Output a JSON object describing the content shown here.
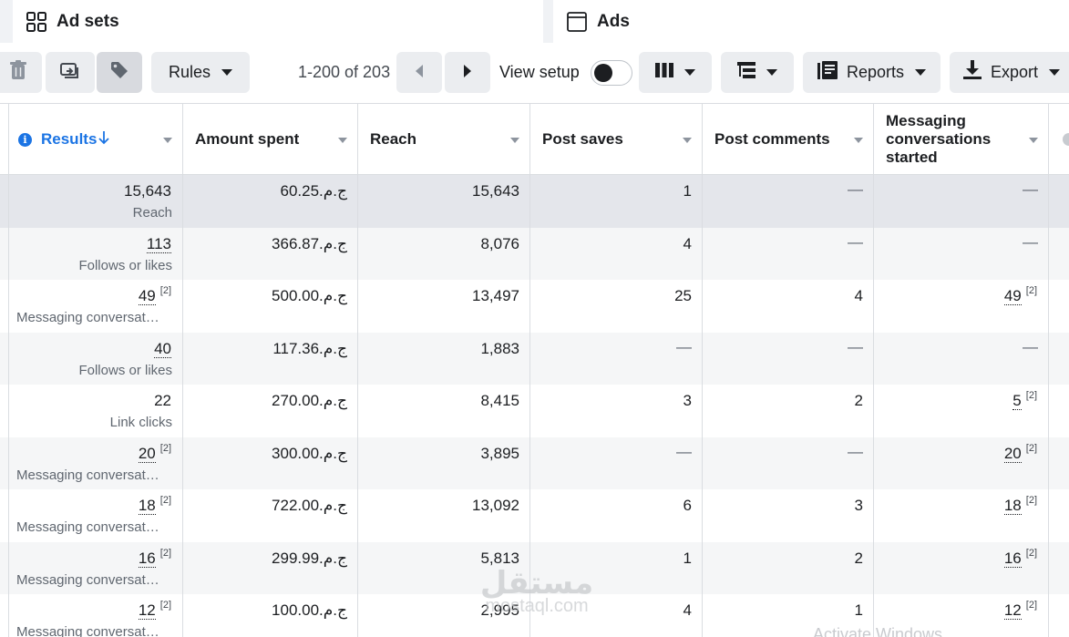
{
  "tabs": {
    "adsets_label": "Ad sets",
    "ads_label": "Ads"
  },
  "toolbar": {
    "rules_label": "Rules",
    "pagination": "1-200 of 203",
    "view_setup_label": "View setup",
    "reports_label": "Reports",
    "export_label": "Export"
  },
  "table": {
    "headers": {
      "results": "Results",
      "amount_spent": "Amount spent",
      "reach": "Reach",
      "post_saves": "Post saves",
      "post_comments": "Post comments",
      "messaging": "Messaging conversations started"
    },
    "rows": [
      {
        "results": "15,643",
        "results_sub": "Reach",
        "amount": "ج.م.60.25",
        "reach": "15,643",
        "saves": "1",
        "comments": "—",
        "messaging": "—"
      },
      {
        "results": "113",
        "results_sub": "Follows or likes",
        "amount": "ج.م.366.87",
        "reach": "8,076",
        "saves": "4",
        "comments": "—",
        "messaging": "—"
      },
      {
        "results": "49",
        "results_sub": "Messaging conversat…",
        "amount": "ج.م.500.00",
        "reach": "13,497",
        "saves": "25",
        "comments": "4",
        "messaging": "49"
      },
      {
        "results": "40",
        "results_sub": "Follows or likes",
        "amount": "ج.م.117.36",
        "reach": "1,883",
        "saves": "—",
        "comments": "—",
        "messaging": "—"
      },
      {
        "results": "22",
        "results_sub": "Link clicks",
        "amount": "ج.م.270.00",
        "reach": "8,415",
        "saves": "3",
        "comments": "2",
        "messaging": "5"
      },
      {
        "results": "20",
        "results_sub": "Messaging conversat…",
        "amount": "ج.م.300.00",
        "reach": "3,895",
        "saves": "—",
        "comments": "—",
        "messaging": "20"
      },
      {
        "results": "18",
        "results_sub": "Messaging conversat…",
        "amount": "ج.م.722.00",
        "reach": "13,092",
        "saves": "6",
        "comments": "3",
        "messaging": "18"
      },
      {
        "results": "16",
        "results_sub": "Messaging conversat…",
        "amount": "ج.م.299.99",
        "reach": "5,813",
        "saves": "1",
        "comments": "2",
        "messaging": "16"
      },
      {
        "results": "12",
        "results_sub": "Messaging conversat…",
        "amount": "ج.م.100.00",
        "reach": "2,995",
        "saves": "4",
        "comments": "1",
        "messaging": "12"
      }
    ],
    "footnote_marker": "[2]"
  },
  "watermark": {
    "line1": "مستقل",
    "line2": "mostaql.com"
  },
  "system_overlay": "Activate Windows",
  "colors": {
    "accent": "#1b74e4",
    "button_bg": "#ebedf0",
    "summary_row": "#e4e6eb",
    "alt_row": "#f5f6f7"
  }
}
